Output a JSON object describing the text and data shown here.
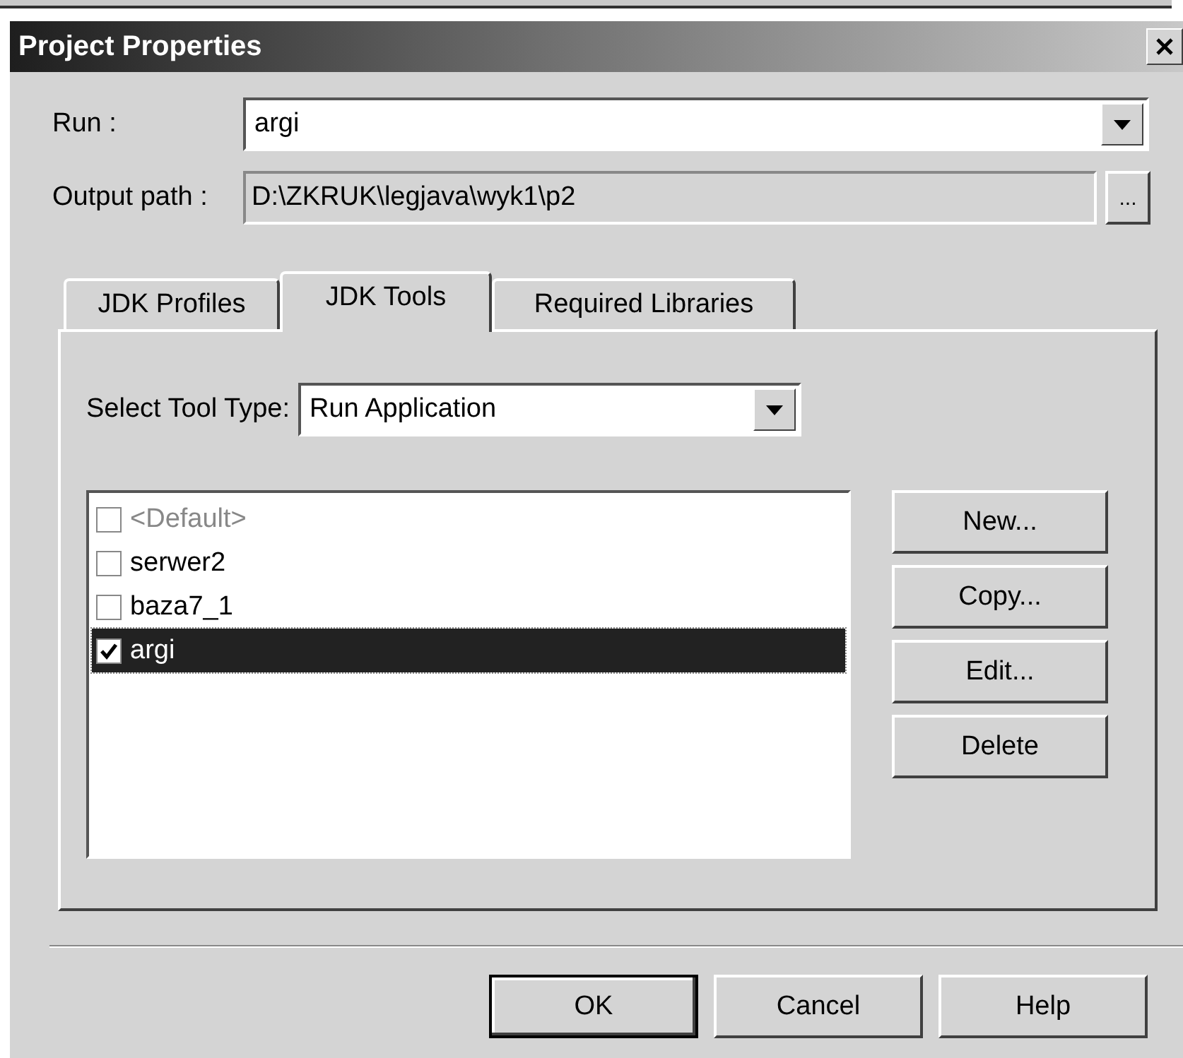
{
  "window": {
    "title": "Project Properties"
  },
  "run": {
    "label": "Run :",
    "value": "argi"
  },
  "output_path": {
    "label": "Output path :",
    "value": "D:\\ZKRUK\\legjava\\wyk1\\p2",
    "browse": "..."
  },
  "tabs": [
    {
      "label": "JDK Profiles",
      "selected": false
    },
    {
      "label": "JDK Tools",
      "selected": true
    },
    {
      "label": "Required Libraries",
      "selected": false
    }
  ],
  "tool_type": {
    "label": "Select Tool Type:",
    "value": "Run Application"
  },
  "tools": [
    {
      "label": "<Default>",
      "checked": false,
      "disabled": true,
      "selected": false
    },
    {
      "label": "serwer2",
      "checked": false,
      "disabled": false,
      "selected": false
    },
    {
      "label": "baza7_1",
      "checked": false,
      "disabled": false,
      "selected": false
    },
    {
      "label": "argi",
      "checked": true,
      "disabled": false,
      "selected": true
    }
  ],
  "tool_buttons": [
    "New...",
    "Copy...",
    "Edit...",
    "Delete"
  ],
  "dialog_buttons": [
    {
      "label": "OK",
      "default": true
    },
    {
      "label": "Cancel",
      "default": false
    },
    {
      "label": "Help",
      "default": false
    }
  ]
}
